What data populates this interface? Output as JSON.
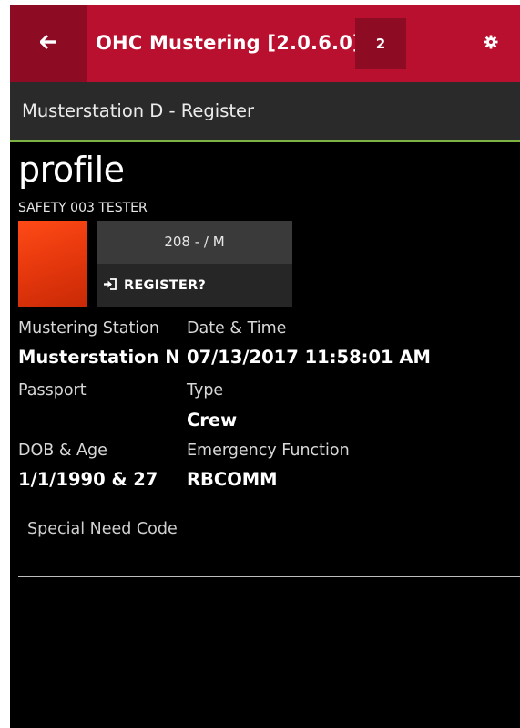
{
  "header": {
    "title": "OHC Mustering [2.0.6.0]",
    "badge_count": "2",
    "back_icon": "arrow-left-icon",
    "settings_icon": "gear-icon",
    "accent_color": "#b8102e",
    "accent_dark": "#8e0b24"
  },
  "subheader": {
    "title": "Musterstation D - Register",
    "underline_color": "#7cb342"
  },
  "profile": {
    "heading": "profile",
    "name": "SAFETY 003 TESTER",
    "id_line": "208 -  / M",
    "register_label": "REGISTER?",
    "register_icon": "sign-in-icon"
  },
  "details": {
    "mustering_station_label": "Mustering Station",
    "mustering_station_value": "Musterstation N",
    "date_time_label": "Date & Time",
    "date_time_value": "07/13/2017 11:58:01 AM",
    "passport_label": "Passport",
    "passport_value": "",
    "type_label": "Type",
    "type_value": "Crew",
    "dob_age_label": "DOB & Age",
    "dob_age_value": "1/1/1990 & 27",
    "emergency_function_label": "Emergency Function",
    "emergency_function_value": "RBCOMM"
  },
  "special_need": {
    "label": "Special Need Code",
    "value": ""
  }
}
